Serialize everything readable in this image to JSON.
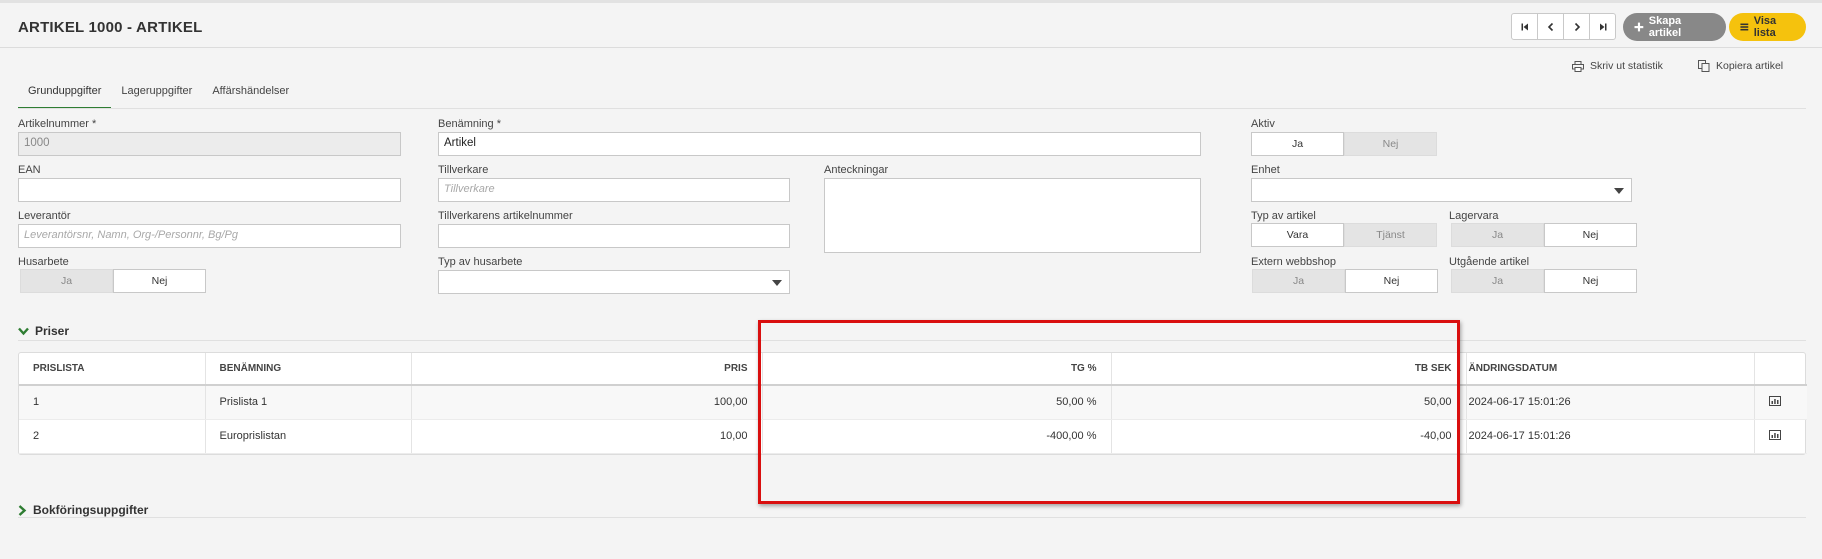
{
  "header": {
    "title": "ARTIKEL 1000 - ARTIKEL",
    "create_label": "Skapa artikel",
    "list_label": "Visa lista"
  },
  "actions": {
    "print_label": "Skriv ut statistik",
    "copy_label": "Kopiera artikel"
  },
  "tabs": [
    {
      "label": "Grunduppgifter",
      "active": true
    },
    {
      "label": "Lageruppgifter",
      "active": false
    },
    {
      "label": "Affärshändelser",
      "active": false
    }
  ],
  "form": {
    "artikelnummer": {
      "label": "Artikelnummer *",
      "value": "1000"
    },
    "ean": {
      "label": "EAN",
      "value": ""
    },
    "leverantor": {
      "label": "Leverantör",
      "placeholder": "Leverantörsnr, Namn, Org-/Personnr, Bg/Pg"
    },
    "husarbete": {
      "label": "Husarbete",
      "yes": "Ja",
      "no": "Nej"
    },
    "benamning": {
      "label": "Benämning *",
      "value": "Artikel"
    },
    "tillverkare": {
      "label": "Tillverkare",
      "placeholder": "Tillverkare"
    },
    "tillverkarens_nr": {
      "label": "Tillverkarens artikelnummer",
      "value": ""
    },
    "typ_husarbete": {
      "label": "Typ av husarbete",
      "value": ""
    },
    "anteckningar": {
      "label": "Anteckningar",
      "value": ""
    },
    "aktiv": {
      "label": "Aktiv",
      "yes": "Ja",
      "no": "Nej"
    },
    "enhet": {
      "label": "Enhet",
      "value": ""
    },
    "typ_artikel": {
      "label": "Typ av artikel",
      "opt1": "Vara",
      "opt2": "Tjänst"
    },
    "lagervara": {
      "label": "Lagervara",
      "yes": "Ja",
      "no": "Nej"
    },
    "extern_webbshop": {
      "label": "Extern webbshop",
      "yes": "Ja",
      "no": "Nej"
    },
    "utgaende": {
      "label": "Utgående artikel",
      "yes": "Ja",
      "no": "Nej"
    }
  },
  "prices": {
    "section_title": "Priser",
    "columns": [
      "PRISLISTA",
      "BENÄMNING",
      "PRIS",
      "TG %",
      "TB SEK",
      "ÄNDRINGSDATUM",
      ""
    ],
    "rows": [
      {
        "prislista": "1",
        "benamning": "Prislista 1",
        "pris": "100,00",
        "tg": "50,00 %",
        "tb": "50,00",
        "datum": "2024-06-17 15:01:26"
      },
      {
        "prislista": "2",
        "benamning": "Europrislistan",
        "pris": "10,00",
        "tg": "-400,00 %",
        "tb": "-40,00",
        "datum": "2024-06-17 15:01:26"
      }
    ]
  },
  "bookkeeping": {
    "section_title": "Bokföringsuppgifter"
  },
  "colors": {
    "accent_green": "#2e7d32",
    "button_yellow": "#f5c20d",
    "button_grey": "#888888",
    "highlight_red": "#d90f0f"
  }
}
